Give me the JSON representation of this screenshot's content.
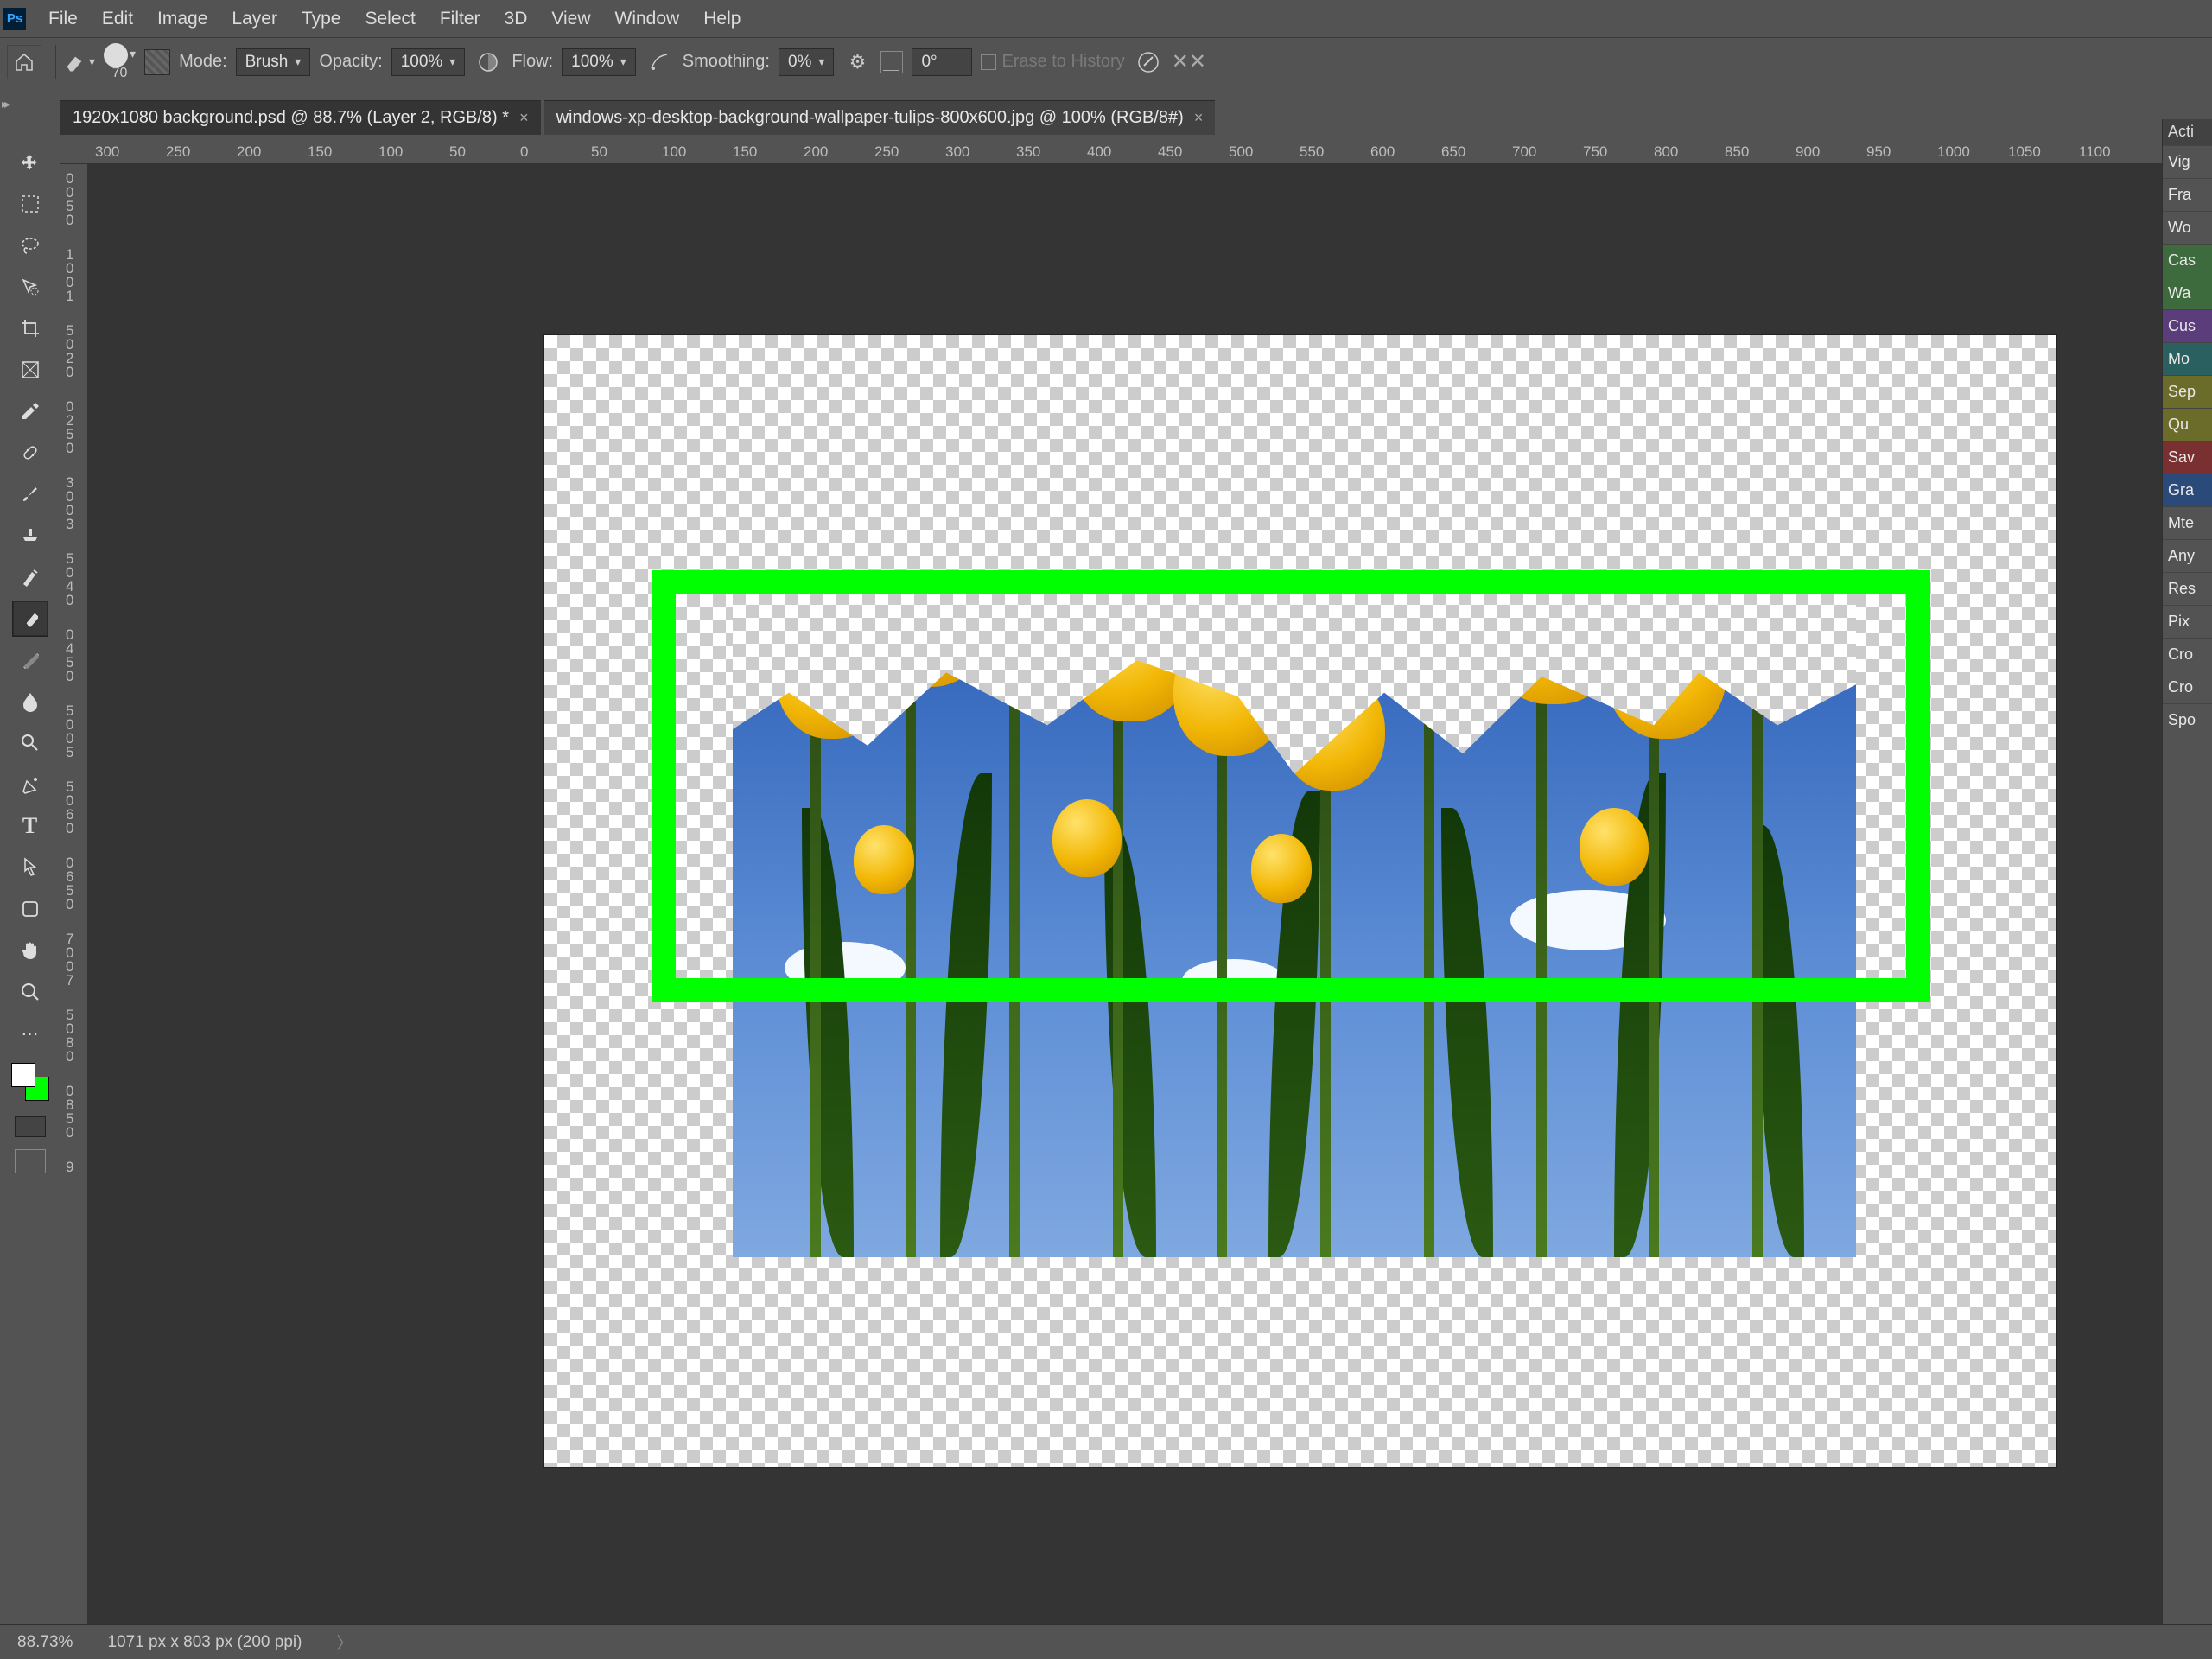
{
  "menu": [
    "File",
    "Edit",
    "Image",
    "Layer",
    "Type",
    "Select",
    "Filter",
    "3D",
    "View",
    "Window",
    "Help"
  ],
  "optbar": {
    "brush_size": "70",
    "mode_label": "Mode:",
    "mode_value": "Brush",
    "opacity_label": "Opacity:",
    "opacity_value": "100%",
    "flow_label": "Flow:",
    "flow_value": "100%",
    "smoothing_label": "Smoothing:",
    "smoothing_value": "0%",
    "angle_value": "0°",
    "erase_history": "Erase to History"
  },
  "tabs": [
    {
      "label": "1920x1080 background.psd @ 88.7% (Layer 2, RGB/8) *",
      "active": true
    },
    {
      "label": "windows-xp-desktop-background-wallpaper-tulips-800x600.jpg @ 100% (RGB/8#)",
      "active": false
    }
  ],
  "ruler_h": [
    "300",
    "250",
    "200",
    "150",
    "100",
    "50",
    "0",
    "50",
    "100",
    "150",
    "200",
    "250",
    "300",
    "350",
    "400",
    "450",
    "500",
    "550",
    "600",
    "650",
    "700",
    "750",
    "800",
    "850",
    "900",
    "950",
    "1000",
    "1050",
    "1100"
  ],
  "ruler_v": [
    "0",
    "0",
    "5",
    "0",
    "1",
    "0",
    "0",
    "1",
    "5",
    "0",
    "2",
    "0",
    "0",
    "2",
    "5",
    "0",
    "3",
    "0",
    "0",
    "3",
    "5",
    "0",
    "4",
    "0",
    "0",
    "4",
    "5",
    "0",
    "5",
    "0",
    "0",
    "5",
    "5",
    "0",
    "6",
    "0",
    "0",
    "6",
    "5",
    "0",
    "7",
    "0",
    "0",
    "7",
    "5",
    "0",
    "8",
    "0",
    "0",
    "8",
    "5",
    "0",
    "9"
  ],
  "actions_header": "Acti",
  "actions": [
    {
      "label": "Vig",
      "cls": ""
    },
    {
      "label": "Fra",
      "cls": ""
    },
    {
      "label": "Wo",
      "cls": ""
    },
    {
      "label": "Cas",
      "cls": "c-green"
    },
    {
      "label": "Wa",
      "cls": "c-green"
    },
    {
      "label": "Cus",
      "cls": "c-purple"
    },
    {
      "label": "Mo",
      "cls": "c-teal"
    },
    {
      "label": "Sep",
      "cls": "c-olive"
    },
    {
      "label": "Qu",
      "cls": "c-olive"
    },
    {
      "label": "Sav",
      "cls": "c-red"
    },
    {
      "label": "Gra",
      "cls": "c-blue"
    },
    {
      "label": "Mte",
      "cls": ""
    },
    {
      "label": "Any",
      "cls": ""
    },
    {
      "label": "Res",
      "cls": ""
    },
    {
      "label": "Pix",
      "cls": ""
    },
    {
      "label": "Cro",
      "cls": ""
    },
    {
      "label": "Cro",
      "cls": ""
    },
    {
      "label": "Spo",
      "cls": ""
    }
  ],
  "status": {
    "zoom": "88.73%",
    "dims": "1071 px x 803 px (200 ppi)"
  }
}
